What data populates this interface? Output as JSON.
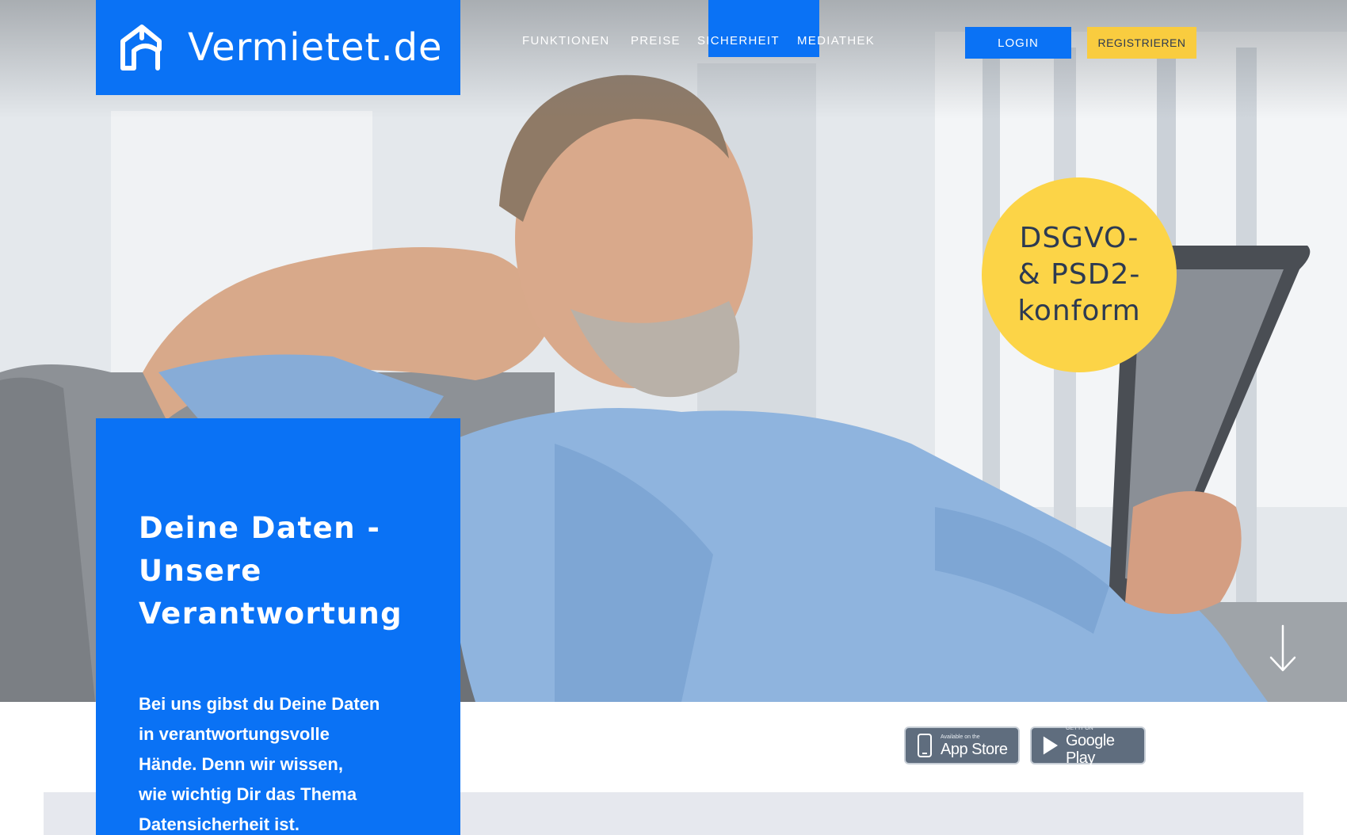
{
  "brand": {
    "name": "Vermietet.de",
    "color_primary": "#0a72f5",
    "color_accent": "#f9cc3f",
    "logo_icon": "house-icon"
  },
  "nav": {
    "items": [
      {
        "label": "FUNKTIONEN"
      },
      {
        "label": "PREISE"
      },
      {
        "label": "SICHERHEIT",
        "active": true
      },
      {
        "label": "MEDIATHEK"
      }
    ],
    "login_label": "LOGIN",
    "register_label": "REGISTRIEREN"
  },
  "badge": {
    "line1": "DSGVO-",
    "line2": "& PSD2-",
    "line3": "konform"
  },
  "hero": {
    "title_line1": "Deine Daten -",
    "title_line2": "Unsere",
    "title_line3": "Verantwortung",
    "body_line1": "Bei uns gibst du Deine Daten",
    "body_line2": "in verantwortungsvolle",
    "body_line3": "Hände. Denn wir wissen,",
    "body_line4": "wie wichtig Dir das Thema",
    "body_line5": "Datensicherheit ist.",
    "scroll_icon": "arrow-down-icon"
  },
  "stores": {
    "appstore_small": "Available on the",
    "appstore_big": "App Store",
    "google_small": "GET IT ON",
    "google_big": "Google Play"
  }
}
